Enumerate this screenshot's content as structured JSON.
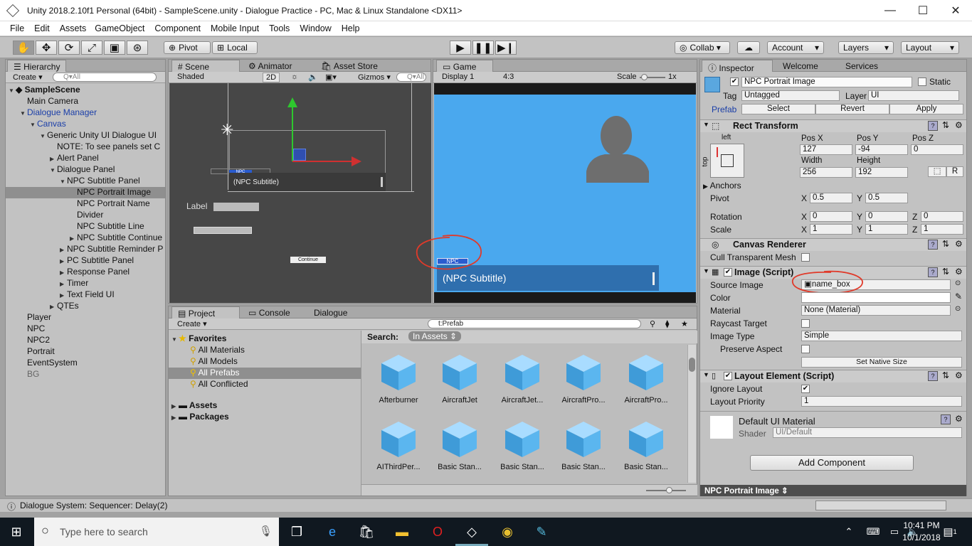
{
  "window": {
    "title": "Unity 2018.2.10f1 Personal (64bit) - SampleScene.unity - Dialogue Practice - PC, Mac & Linux Standalone <DX11>",
    "min": "—",
    "max": "☐",
    "close": "✕"
  },
  "menu": [
    "File",
    "Edit",
    "Assets",
    "GameObject",
    "Component",
    "Mobile Input",
    "Tools",
    "Window",
    "Help"
  ],
  "toolbar": {
    "pivot": "Pivot",
    "local": "Local",
    "collab": "Collab ▾",
    "account": "Account",
    "layers": "Layers",
    "layout": "Layout"
  },
  "hierarchy": {
    "tab": "Hierarchy",
    "create": "Create ▾",
    "search_placeholder": "Q▾All",
    "scene": "SampleScene",
    "items": [
      "Main Camera",
      "Dialogue Manager",
      "Canvas",
      "Generic Unity UI Dialogue UI",
      "NOTE: To see panels set C",
      "Alert Panel",
      "Dialogue Panel",
      "NPC Subtitle Panel",
      "NPC Portrait Image",
      "NPC Portrait Name",
      "Divider",
      "NPC Subtitle Line",
      "NPC Subtitle Continue",
      "NPC Subtitle Reminder P",
      "PC Subtitle Panel",
      "Response Panel",
      "Timer",
      "Text Field UI",
      "QTEs",
      "Player",
      "NPC",
      "NPC2",
      "Portrait",
      "EventSystem",
      "BG"
    ]
  },
  "scene": {
    "tabs": [
      "Scene",
      "Animator",
      "Asset Store"
    ],
    "shaded": "Shaded",
    "mode2d": "2D",
    "gizmos": "Gizmos ▾",
    "search": "Q▾All",
    "npc": "NPC",
    "subtitle": "(NPC Subtitle)",
    "label": "Label",
    "continue": "Continue"
  },
  "game": {
    "tab": "Game",
    "display": "Display 1",
    "aspect": "4:3",
    "scale_label": "Scale",
    "scale_val": "1x",
    "npc": "NPC",
    "subtitle": "(NPC Subtitle)"
  },
  "inspector": {
    "tabs": [
      "Inspector",
      "Welcome",
      "Services"
    ],
    "object_name": "NPC Portrait Image",
    "static": "Static",
    "tag_label": "Tag",
    "tag": "Untagged",
    "layer_label": "Layer",
    "layer": "UI",
    "prefab_label": "Prefab",
    "select": "Select",
    "revert": "Revert",
    "apply": "Apply",
    "rect": {
      "title": "Rect Transform",
      "left": "left",
      "top": "top",
      "posx_l": "Pos X",
      "posy_l": "Pos Y",
      "posz_l": "Pos Z",
      "posx": "127",
      "posy": "-94",
      "posz": "0",
      "width_l": "Width",
      "height_l": "Height",
      "width": "256",
      "height": "192",
      "anchors": "Anchors",
      "pivot": "Pivot",
      "pivx": "0.5",
      "pivy": "0.5",
      "rotation": "Rotation",
      "rx": "0",
      "ry": "0",
      "rz": "0",
      "scale": "Scale",
      "sx": "1",
      "sy": "1",
      "sz": "1",
      "x": "X",
      "y": "Y",
      "z": "Z",
      "R": "R"
    },
    "canvas_renderer": {
      "title": "Canvas Renderer",
      "cull": "Cull Transparent Mesh"
    },
    "image": {
      "title": "Image (Script)",
      "source_l": "Source Image",
      "source": "name_box",
      "color_l": "Color",
      "material_l": "Material",
      "material": "None (Material)",
      "raycast": "Raycast Target",
      "type_l": "Image Type",
      "type": "Simple",
      "preserve": "Preserve Aspect",
      "native": "Set Native Size"
    },
    "layout_el": {
      "title": "Layout Element (Script)",
      "ignore": "Ignore Layout",
      "priority_l": "Layout Priority",
      "priority": "1"
    },
    "material": {
      "title": "Default UI Material",
      "shader_l": "Shader",
      "shader": "UI/Default"
    },
    "add": "Add Component",
    "footer": "NPC Portrait Image ⇕"
  },
  "project": {
    "tabs": [
      "Project",
      "Console",
      "Dialogue"
    ],
    "create": "Create ▾",
    "search": "t:Prefab",
    "favorites": "Favorites",
    "fav_items": [
      "All Materials",
      "All Models",
      "All Prefabs",
      "All Conflicted"
    ],
    "assets": "Assets",
    "packages": "Packages",
    "search_label": "Search:",
    "in_assets": "In Assets",
    "row1": [
      "Afterburner",
      "AircraftJet",
      "AircraftJet...",
      "AircraftPro...",
      "AircraftPro..."
    ],
    "row2": [
      "AIThirdPer...",
      "Basic Stan...",
      "Basic Stan...",
      "Basic Stan...",
      "Basic Stan..."
    ]
  },
  "status": "Dialogue System: Sequencer: Delay(2)",
  "taskbar": {
    "search": "Type here to search",
    "time": "10:41 PM",
    "date": "10/1/2018",
    "notif": "1"
  },
  "colors": {
    "game_bg": "#4aa8ee",
    "annotation": "#e03a2a",
    "npc_box": "#2a5ccf"
  }
}
